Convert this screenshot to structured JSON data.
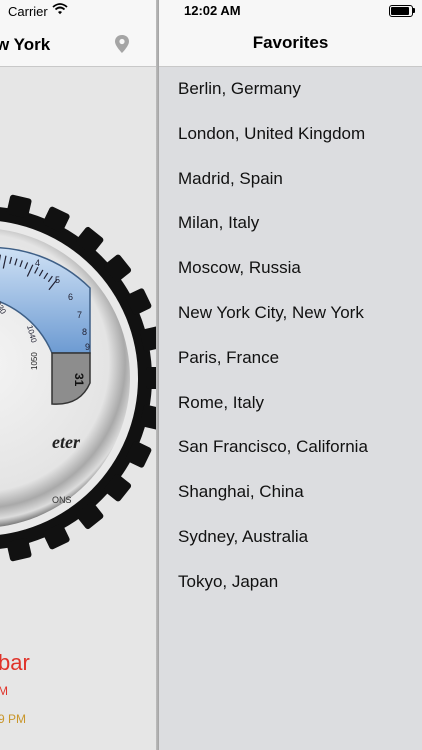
{
  "left_panel": {
    "carrier": "Carrier",
    "title": "w York",
    "readout": "bar",
    "sub1": "M",
    "sub2": "9 PM",
    "gauge_text": {
      "scale_labels": [
        "4",
        "5",
        "6",
        "7",
        "8",
        "9"
      ],
      "numbers": [
        "030",
        "1040",
        "1050"
      ],
      "counter": "31",
      "brand": "eter",
      "conditions": "ONS"
    }
  },
  "status_bar": {
    "time": "12:02 AM"
  },
  "favorites": {
    "title": "Favorites",
    "items": [
      "Berlin, Germany",
      "London, United Kingdom",
      "Madrid, Spain",
      "Milan, Italy",
      "Moscow, Russia",
      "New York City, New York",
      "Paris, France",
      "Rome, Italy",
      "San Francisco, California",
      "Shanghai, China",
      "Sydney, Australia",
      "Tokyo, Japan"
    ]
  },
  "colors": {
    "accent_red": "#e0332a",
    "gauge_blue": "#7fa8d8"
  },
  "icons": [
    "wifi-icon",
    "location-pin-icon",
    "battery-icon"
  ]
}
